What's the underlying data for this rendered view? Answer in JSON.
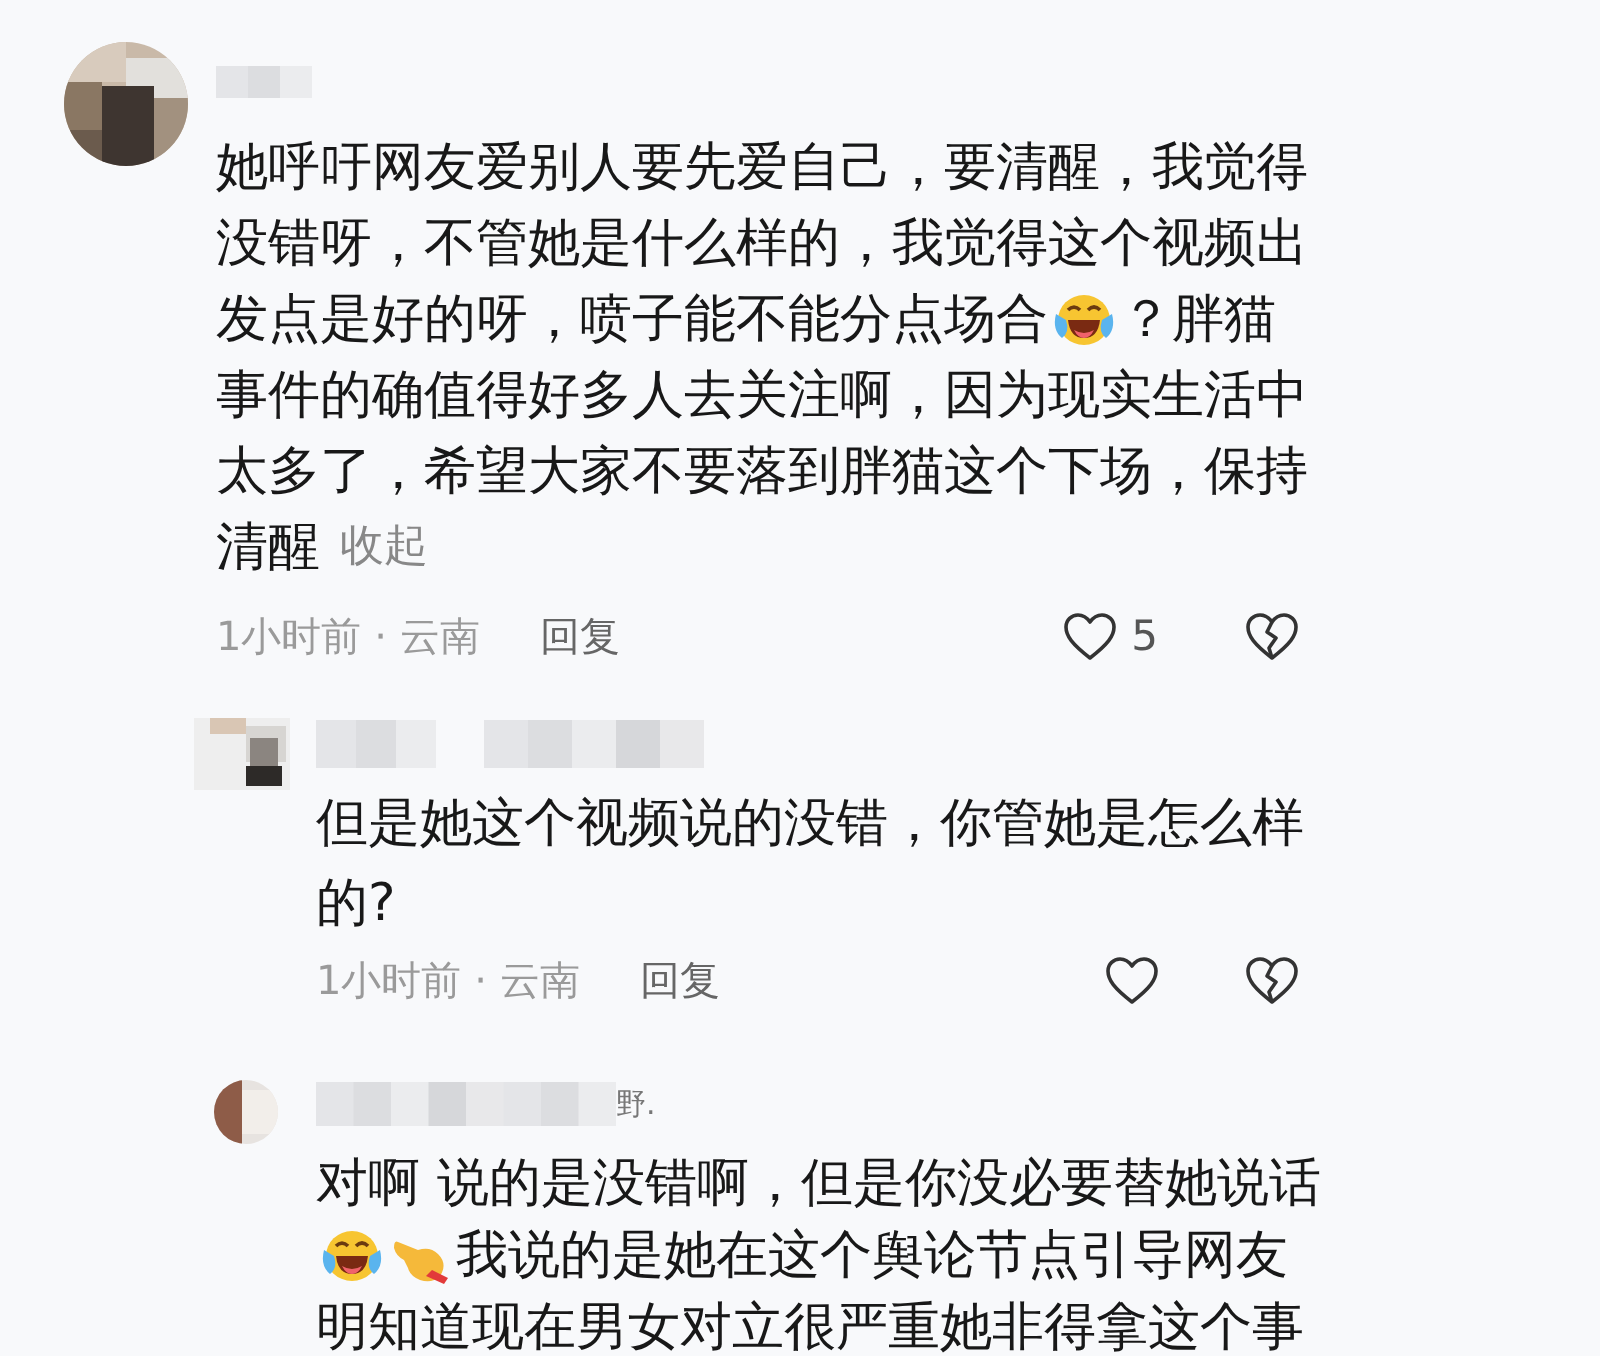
{
  "comments": [
    {
      "kind": "comment",
      "lines": [
        [
          {
            "kind": "text",
            "text": "她呼吁网友爱别人要先爱自己，要清醒，我觉得"
          }
        ],
        [
          {
            "kind": "text",
            "text": "没错呀，不管她是什么样的，我觉得这个视频出"
          }
        ],
        [
          {
            "kind": "text",
            "text": "发点是好的呀，喷子能不能分点场合"
          },
          {
            "kind": "laughcry"
          },
          {
            "kind": "text",
            "text": "？胖猫"
          }
        ],
        [
          {
            "kind": "text",
            "text": "事件的确值得好多人去关注啊，因为现实生活中"
          }
        ],
        [
          {
            "kind": "text",
            "text": "太多了，希望大家不要落到胖猫这个下场，保持"
          }
        ],
        [
          {
            "kind": "text",
            "text": "清醒"
          },
          {
            "kind": "link",
            "text": "收起"
          }
        ]
      ],
      "meta": {
        "time": "1小时前 · 云南",
        "reply": "回复",
        "likes": "5"
      }
    },
    {
      "kind": "reply",
      "lines": [
        [
          {
            "kind": "text",
            "text": "但是她这个视频说的没错，你管她是怎么样"
          }
        ],
        [
          {
            "kind": "text",
            "text": "的?"
          }
        ]
      ],
      "meta": {
        "time": "1小时前 · 云南",
        "reply": "回复"
      }
    },
    {
      "kind": "reply",
      "name_suffix": "野.",
      "lines": [
        [
          {
            "kind": "text",
            "text": "对啊 说的是没错啊，但是你没必要替她说话"
          }
        ],
        [
          {
            "kind": "laughcry"
          },
          {
            "kind": "pointing"
          },
          {
            "kind": "text",
            "text": "我说的是她在这个舆论节点引导网友"
          }
        ],
        [
          {
            "kind": "text",
            "text": "明知道现在男女对立很严重她非得拿这个事"
          }
        ]
      ]
    }
  ]
}
